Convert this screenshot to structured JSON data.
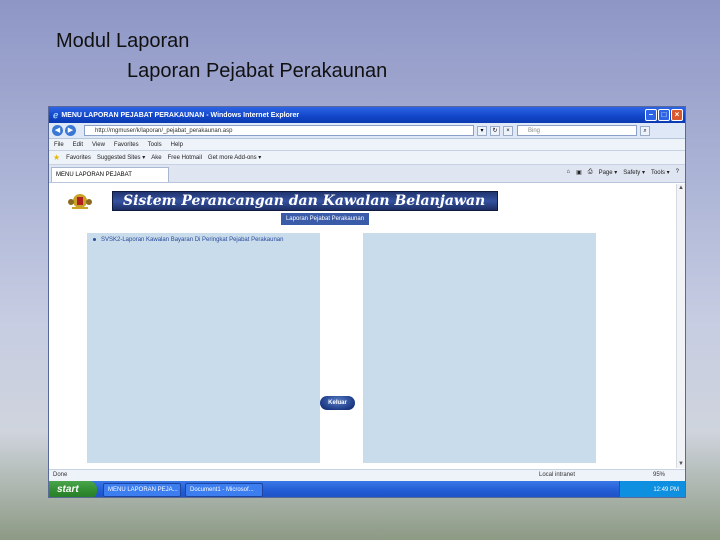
{
  "slide": {
    "title": "Modul Laporan",
    "subtitle": "Laporan Pejabat Perakaunan"
  },
  "browser": {
    "window_title": "MENU LAPORAN PEJABAT PERAKAUNAN - Windows Internet Explorer",
    "address": "http://mgmuser/k/laporan/_pejabat_perakaunan.asp",
    "search_placeholder": "Bing",
    "menu": [
      "File",
      "Edit",
      "View",
      "Favorites",
      "Tools",
      "Help"
    ],
    "favorites_label": "Favorites",
    "favorites_items": [
      "Suggested Sites ▾",
      "Ake",
      "Free Hotmail",
      "Get more Add-ons ▾"
    ],
    "tab_label": "MENU LAPORAN PEJABAT PERAKAUNAN",
    "command_items": [
      "Page ▾",
      "Safety ▾",
      "Tools ▾"
    ]
  },
  "page": {
    "banner_title": "Sistem Perancangan dan Kawalan Belanjawan",
    "section_label": "Laporan Pejabat Perakaunan",
    "report_item": "SVSK2-Laporan Kawalan Bayaran Di Peringkat Pejabat Perakaunan",
    "exit_label": "Keluar"
  },
  "status": {
    "left": "Done",
    "zone": "Local intranet",
    "zoom": "95%"
  },
  "taskbar": {
    "start_label": "start",
    "tasks": [
      "MENU LAPORAN PEJA...",
      "Document1 - Microsof..."
    ],
    "clock": "12:49 PM"
  },
  "colors": {
    "banner": "#20346e",
    "panel": "#c8dcec",
    "taskbar": "#245dd6"
  }
}
